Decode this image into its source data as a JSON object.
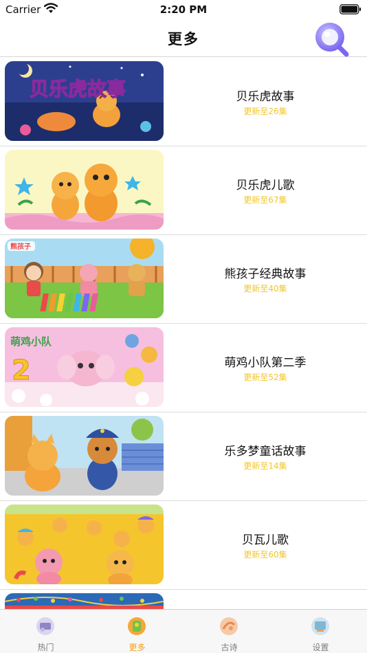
{
  "status_bar": {
    "carrier": "Carrier",
    "time": "2:20 PM"
  },
  "nav": {
    "title": "更多"
  },
  "list": [
    {
      "title": "贝乐虎故事",
      "subtitle": "更新至26集",
      "thumb_text": "贝乐虎故事"
    },
    {
      "title": "贝乐虎儿歌",
      "subtitle": "更新至67集"
    },
    {
      "title": "熊孩子经典故事",
      "subtitle": "更新至40集",
      "thumb_text": "熊孩子"
    },
    {
      "title": "萌鸡小队第二季",
      "subtitle": "更新至52集",
      "thumb_text": "萌鸡小队",
      "thumb_number": "2"
    },
    {
      "title": "乐多梦童话故事",
      "subtitle": "更新至14集"
    },
    {
      "title": "贝瓦儿歌",
      "subtitle": "更新至60集"
    },
    {
      "title": "",
      "subtitle": ""
    }
  ],
  "tabs": [
    {
      "label": "热门",
      "icon": "hot-icon",
      "active": false
    },
    {
      "label": "更多",
      "icon": "more-icon",
      "active": true
    },
    {
      "label": "古诗",
      "icon": "poem-icon",
      "active": false
    },
    {
      "label": "设置",
      "icon": "settings-icon",
      "active": false
    }
  ],
  "colors": {
    "accent": "#f3a019",
    "subtitle": "#f3c62a",
    "search": "#8b7cf6"
  }
}
